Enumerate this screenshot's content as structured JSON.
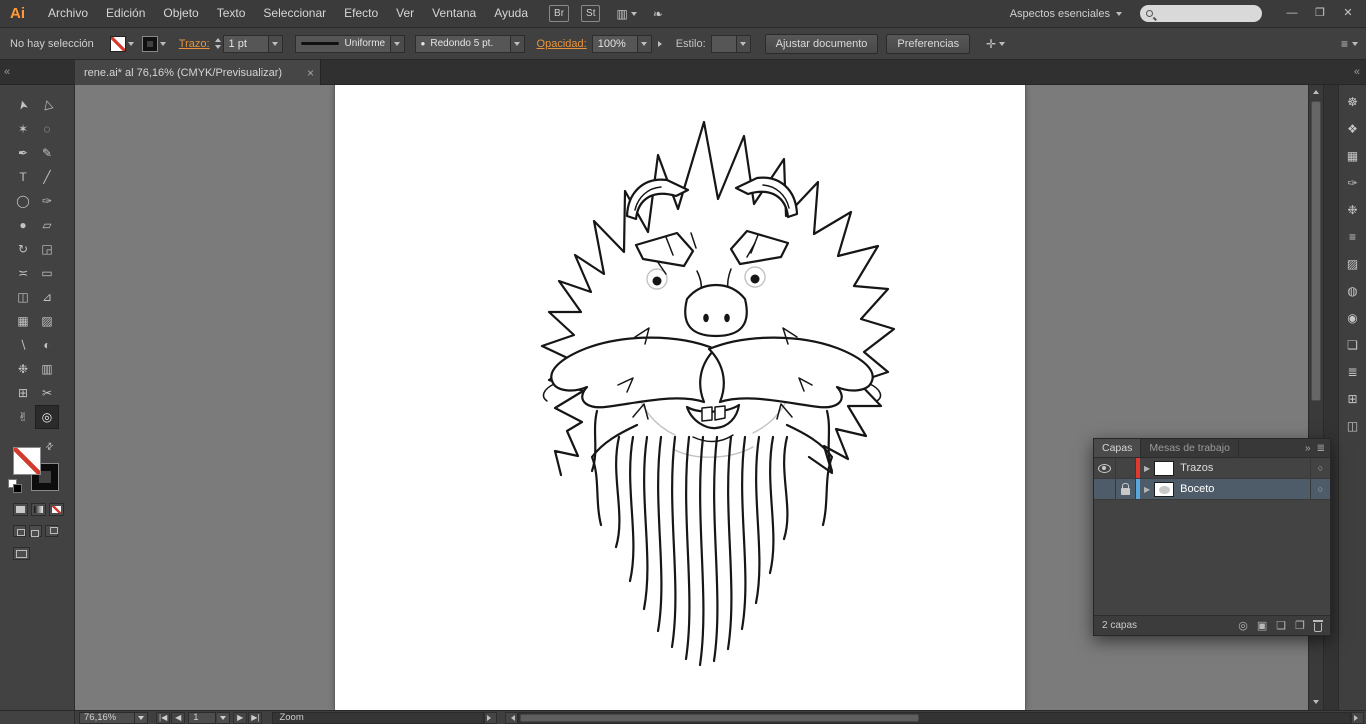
{
  "menubar": {
    "logo": "Ai",
    "items": [
      "Archivo",
      "Edición",
      "Objeto",
      "Texto",
      "Seleccionar",
      "Efecto",
      "Ver",
      "Ventana",
      "Ayuda"
    ],
    "bridge": "Br",
    "stock": "St",
    "workspace": "Aspectos esenciales"
  },
  "window": {
    "minimize": "—",
    "restore": "❐",
    "close": "✕"
  },
  "control_bar": {
    "selection_status": "No hay selección",
    "stroke_label": "Trazo:",
    "stroke_value": "1 pt",
    "width_profile": "Uniforme",
    "brush": "Redondo 5 pt.",
    "opacity_label": "Opacidad:",
    "opacity_value": "100%",
    "style_label": "Estilo:",
    "fit_document": "Ajustar documento",
    "preferences": "Preferencias"
  },
  "document_tab": {
    "title": "rene.ai* al 76,16% (CMYK/Previsualizar)",
    "close": "×"
  },
  "tools": [
    {
      "name": "selection-tool",
      "glyph": "➤"
    },
    {
      "name": "direct-selection-tool",
      "glyph": "▷"
    },
    {
      "name": "magic-wand-tool",
      "glyph": "✶"
    },
    {
      "name": "lasso-tool",
      "glyph": "◌"
    },
    {
      "name": "pen-tool",
      "glyph": "✒"
    },
    {
      "name": "pencil-tool",
      "glyph": "✎"
    },
    {
      "name": "type-tool",
      "glyph": "T"
    },
    {
      "name": "line-segment-tool",
      "glyph": "╱"
    },
    {
      "name": "ellipse-tool",
      "glyph": "◯"
    },
    {
      "name": "paintbrush-tool",
      "glyph": "✑"
    },
    {
      "name": "blob-brush-tool",
      "glyph": "●"
    },
    {
      "name": "eraser-tool",
      "glyph": "▱"
    },
    {
      "name": "rotate-tool",
      "glyph": "↻"
    },
    {
      "name": "scale-tool",
      "glyph": "◲"
    },
    {
      "name": "width-tool",
      "glyph": "≍"
    },
    {
      "name": "free-transform-tool",
      "glyph": "▭"
    },
    {
      "name": "shape-builder-tool",
      "glyph": "◫"
    },
    {
      "name": "perspective-grid-tool",
      "glyph": "⊿"
    },
    {
      "name": "mesh-tool",
      "glyph": "▦"
    },
    {
      "name": "gradient-tool",
      "glyph": "▨"
    },
    {
      "name": "eyedropper-tool",
      "glyph": "∖"
    },
    {
      "name": "blend-tool",
      "glyph": "◐"
    },
    {
      "name": "symbol-sprayer-tool",
      "glyph": "❉"
    },
    {
      "name": "column-graph-tool",
      "glyph": "▥"
    },
    {
      "name": "artboard-tool",
      "glyph": "⊞"
    },
    {
      "name": "slice-tool",
      "glyph": "✂"
    },
    {
      "name": "hand-tool",
      "glyph": "✌"
    },
    {
      "name": "zoom-tool",
      "glyph": "◎",
      "selected": true
    }
  ],
  "dock_icons": [
    {
      "name": "color-panel-icon",
      "glyph": "☸"
    },
    {
      "name": "color-guide-panel-icon",
      "glyph": "❖"
    },
    {
      "name": "swatches-panel-icon",
      "glyph": "▦"
    },
    {
      "name": "brushes-panel-icon",
      "glyph": "✑"
    },
    {
      "name": "symbols-panel-icon",
      "glyph": "❉"
    },
    {
      "name": "stroke-panel-icon",
      "glyph": "≡"
    },
    {
      "name": "gradient-panel-icon",
      "glyph": "▨"
    },
    {
      "name": "transparency-panel-icon",
      "glyph": "◍"
    },
    {
      "name": "appearance-panel-icon",
      "glyph": "◉"
    },
    {
      "name": "graphic-styles-panel-icon",
      "glyph": "❏"
    },
    {
      "name": "layers-panel-icon",
      "glyph": "≣"
    },
    {
      "name": "artboards-panel-icon",
      "glyph": "⊞"
    },
    {
      "name": "navigator-panel-icon",
      "glyph": "◫"
    }
  ],
  "layers_panel": {
    "tabs": [
      "Capas",
      "Mesas de trabajo"
    ],
    "rows": [
      {
        "name": "Trazos",
        "color": "#df3a2d",
        "visible": true,
        "locked": false,
        "selected": false
      },
      {
        "name": "Boceto",
        "color": "#5aa7dd",
        "visible": false,
        "locked": true,
        "selected": true
      }
    ],
    "status": "2 capas",
    "expand_glyph": "▶",
    "target_glyph": "○",
    "collapse_glyph": "»",
    "menu_glyph": "≣",
    "bottom_icons": [
      {
        "name": "locate-object-icon",
        "glyph": "◎"
      },
      {
        "name": "clipping-mask-icon",
        "glyph": "▣"
      },
      {
        "name": "new-sublayer-icon",
        "glyph": "❏"
      },
      {
        "name": "new-layer-icon",
        "glyph": "❐"
      }
    ]
  },
  "status_bar": {
    "zoom": "76,16%",
    "nav_first": "|◀",
    "nav_prev": "◀",
    "artboard": "1",
    "nav_next": "▶",
    "nav_last": "▶|",
    "tool": "Zoom"
  },
  "misc": {
    "collapse_left": "«",
    "collapse_right": "«",
    "arrange_glyph": "▥",
    "cslive_glyph": "❧",
    "panel_options_glyph": "✛",
    "controlbar_menu_glyph": "≡",
    "brush_dot": "●",
    "swap_glyph": "⇄"
  },
  "colors": {
    "accent_orange": "#e8943f",
    "selection_blue": "#4e5c69",
    "canvas_gray": "#7b7b7b",
    "layer_red": "#df3a2d",
    "layer_blue": "#5aa7dd"
  }
}
